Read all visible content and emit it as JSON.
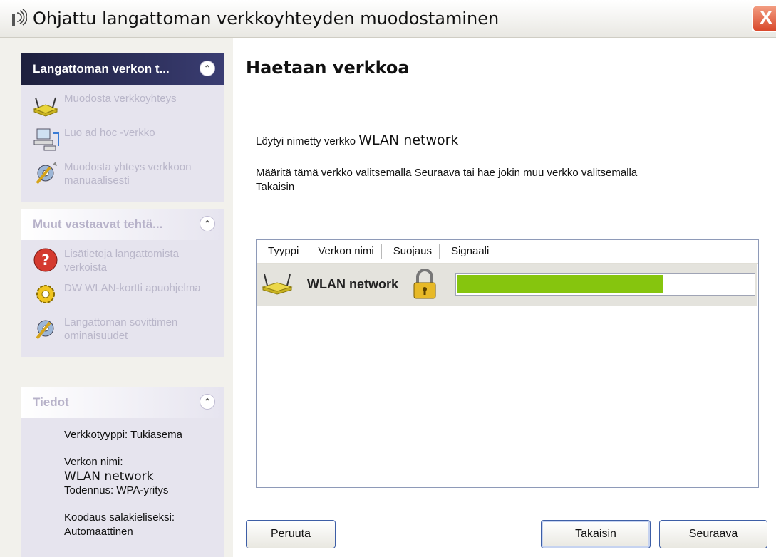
{
  "window": {
    "title": "Ohjattu langattoman verkkoyhteyden muodostaminen",
    "close_glyph": "X"
  },
  "sidebar": {
    "panels": [
      {
        "title": "Langattoman verkon t...",
        "items": [
          {
            "icon": "router-icon",
            "label": "Muodosta verkkoyhteys"
          },
          {
            "icon": "computer-network-icon",
            "label": "Luo ad hoc -verkko"
          },
          {
            "icon": "gear-tools-icon",
            "label": "Muodosta yhteys verkkoon manuaalisesti"
          }
        ]
      },
      {
        "title": "Muut vastaavat tehtä...",
        "items": [
          {
            "icon": "help-icon",
            "label": "Lisätietoja langattomista verkoista"
          },
          {
            "icon": "gear-icon",
            "label": "DW WLAN-kortti apuohjelma"
          },
          {
            "icon": "gear-tools-icon",
            "label": "Langattoman sovittimen ominaisuudet"
          }
        ]
      }
    ],
    "info": {
      "title": "Tiedot",
      "network_type": "Verkkotyyppi: Tukiasema",
      "network_name_label": "Verkon nimi:",
      "network_name": "WLAN network",
      "auth": "Todennus: WPA-yritys",
      "encryption_label": "Koodaus salakieliseksi:",
      "encryption_value": "Automaattinen"
    }
  },
  "main": {
    "heading": "Haetaan verkkoa",
    "found_prefix": "Löytyi nimetty verkko",
    "found_network": "WLAN network",
    "instruction": "Määritä tämä verkko valitsemalla Seuraava tai hae jokin muu verkko valitsemalla Takaisin",
    "columns": [
      "Tyyppi",
      "Verkon nimi",
      "Suojaus",
      "Signaali"
    ],
    "rows": [
      {
        "type_icon": "router-icon",
        "name": "WLAN network",
        "security_icon": "lock-icon",
        "signal": 0.7
      }
    ]
  },
  "buttons": {
    "cancel": "Peruuta",
    "back": "Takaisin",
    "next": "Seuraava"
  }
}
